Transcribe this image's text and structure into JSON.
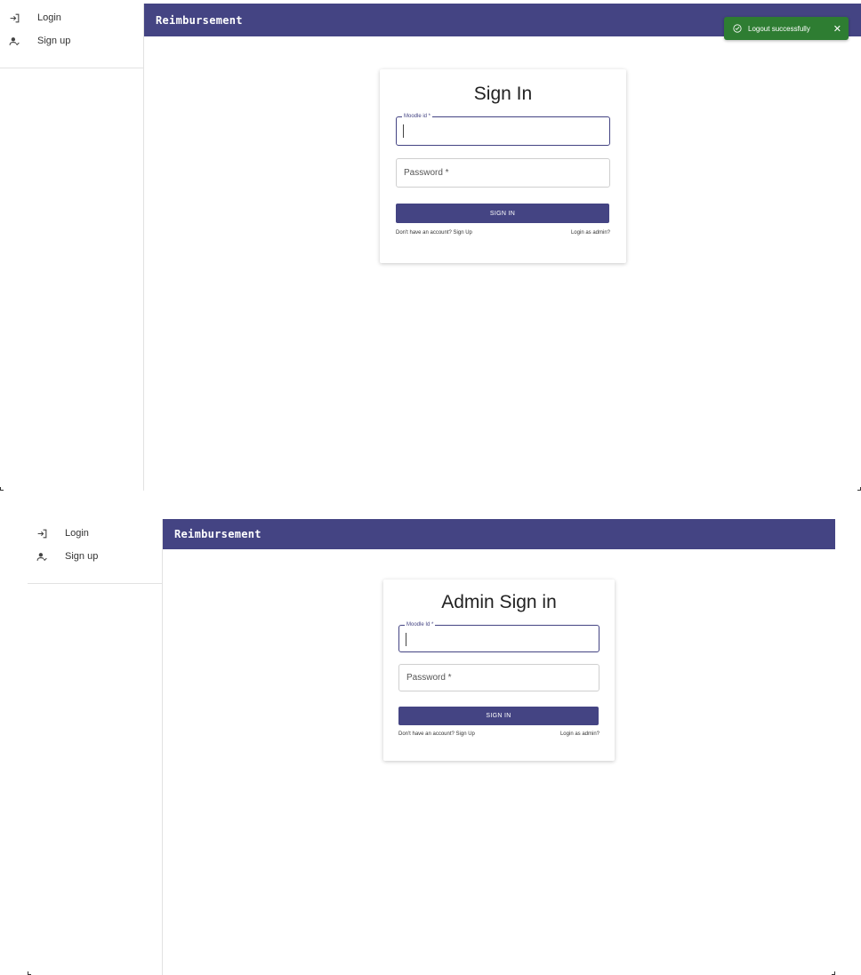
{
  "app": {
    "title": "Reimbursement"
  },
  "sidebar": {
    "items": [
      {
        "label": "Login",
        "icon": "login-icon"
      },
      {
        "label": "Sign up",
        "icon": "person-add-icon"
      }
    ]
  },
  "toast": {
    "message": "Logout successfully",
    "icon": "check-circle-icon",
    "close_icon": "close-icon",
    "color": "#2e7d32"
  },
  "user_signin": {
    "title": "Sign In",
    "moodle_label": "Moodle id *",
    "password_placeholder": "Password *",
    "button": "SIGN IN",
    "signup_link": "Don't have an account? Sign Up",
    "admin_link": "Login as admin?"
  },
  "admin_signin": {
    "title": "Admin Sign in",
    "moodle_label": "Moodle Id *",
    "password_placeholder": "Password *",
    "button": "SIGN IN",
    "signup_link": "Don't have an account? Sign Up",
    "admin_link": "Login as admin?"
  },
  "colors": {
    "accent": "#444483",
    "success": "#2e7d32"
  }
}
